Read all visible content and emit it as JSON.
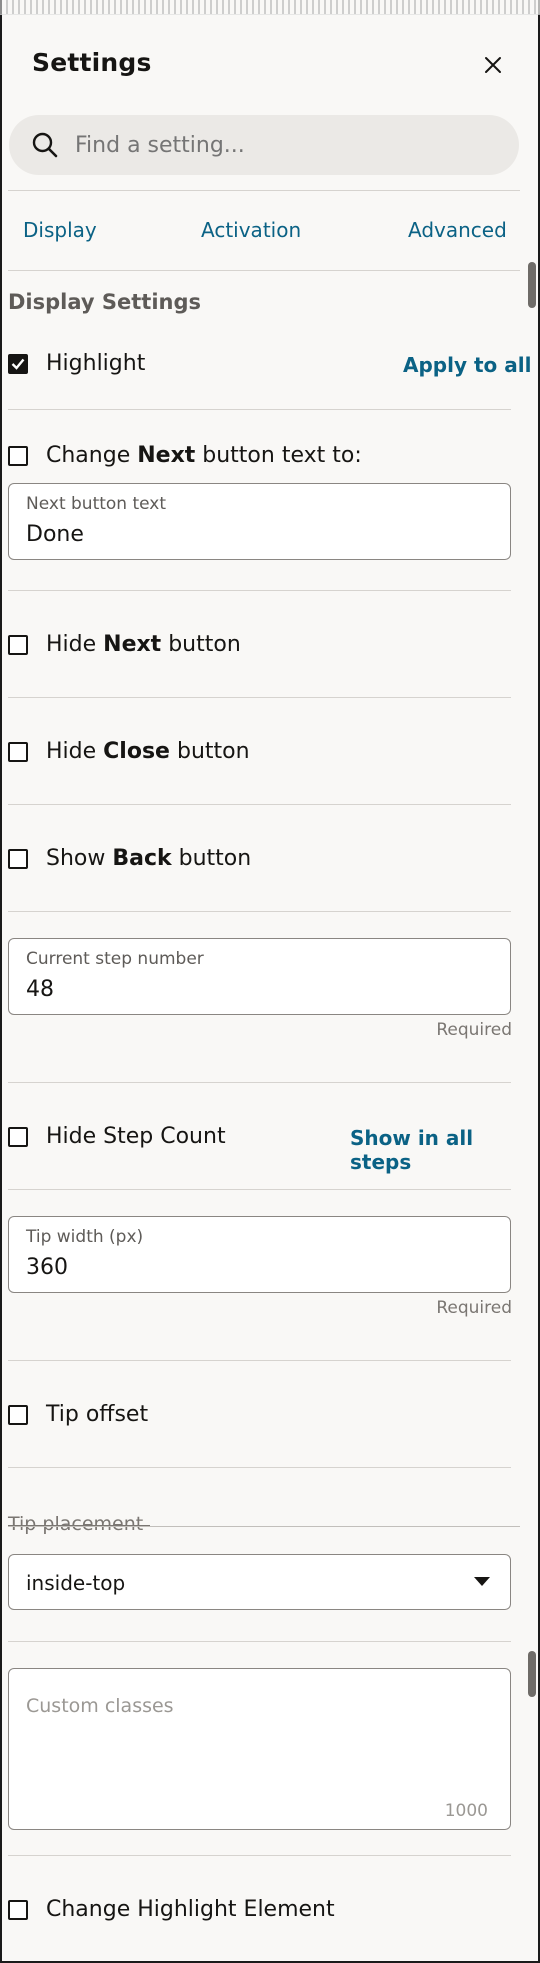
{
  "header": {
    "title": "Settings",
    "close_icon": "close-icon"
  },
  "search": {
    "placeholder": "Find a setting..."
  },
  "tabs": [
    {
      "label": "Display"
    },
    {
      "label": "Activation"
    },
    {
      "label": "Advanced"
    }
  ],
  "section": {
    "title": "Display Settings"
  },
  "highlight": {
    "label": "Highlight",
    "checked": true,
    "apply_link": "Apply to all"
  },
  "change_next": {
    "prefix": "Change ",
    "bold": "Next",
    "suffix": " button text to:",
    "checked": false
  },
  "next_text_field": {
    "label": "Next button text",
    "value": "Done"
  },
  "hide_next": {
    "prefix": "Hide ",
    "bold": "Next",
    "suffix": " button",
    "checked": false
  },
  "hide_close": {
    "prefix": "Hide ",
    "bold": "Close",
    "suffix": " button",
    "checked": false
  },
  "show_back": {
    "prefix": "Show ",
    "bold": "Back",
    "suffix": " button",
    "checked": false
  },
  "step_number_field": {
    "label": "Current step number",
    "value": "48",
    "required": "Required"
  },
  "hide_step_count": {
    "label": "Hide Step Count",
    "checked": false,
    "link": "Show in all steps"
  },
  "tip_width_field": {
    "label": "Tip width (px)",
    "value": "360",
    "required": "Required"
  },
  "tip_offset": {
    "label": "Tip offset",
    "checked": false
  },
  "tip_placement": {
    "label": "Tip placement",
    "value": "inside-top"
  },
  "custom_classes": {
    "placeholder": "Custom classes",
    "counter": "1000"
  },
  "change_highlight": {
    "label": "Change Highlight Element",
    "checked": false
  }
}
